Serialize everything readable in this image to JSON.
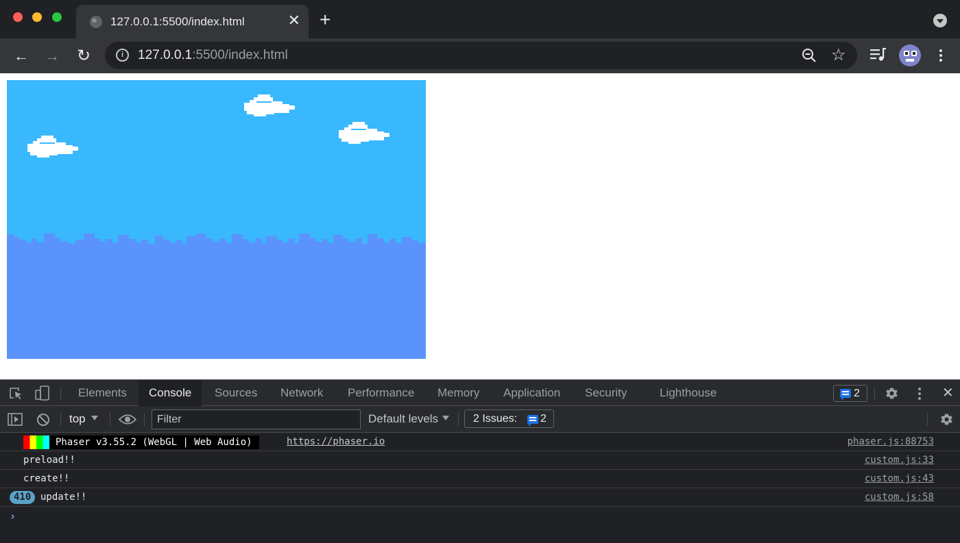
{
  "browser": {
    "tab_title": "127.0.0.1:5500/index.html",
    "tab_close": "✕",
    "new_tab": "+",
    "url_host": "127.0.0.1",
    "url_rest": ":5500/index.html",
    "back": "←",
    "forward": "→",
    "reload": "↻",
    "bookmark": "☆",
    "info": "i"
  },
  "game": {
    "sky_color": "#3ab8fd",
    "skyline_color": "#5a93fc",
    "cloud_color": "#ffffff"
  },
  "devtools": {
    "tabs": [
      "Elements",
      "Console",
      "Sources",
      "Network",
      "Performance",
      "Memory",
      "Application",
      "Security",
      "Lighthouse"
    ],
    "active_tab": "Console",
    "issue_count_badge": "2",
    "context": "top",
    "filter_placeholder": "Filter",
    "levels": "Default levels",
    "issues_label": "2 Issues:",
    "issues_count": "2",
    "close": "✕",
    "console": {
      "banner_text": "Phaser v3.55.2 (WebGL | Web Audio)",
      "banner_link": "https://phaser.io",
      "banner_source": "phaser.js:88753",
      "messages": [
        {
          "text": "preload!!",
          "source": "custom.js:33"
        },
        {
          "text": "create!!",
          "source": "custom.js:43"
        },
        {
          "text": "update!!",
          "source": "custom.js:58",
          "count": "410"
        }
      ],
      "prompt": "›"
    }
  }
}
